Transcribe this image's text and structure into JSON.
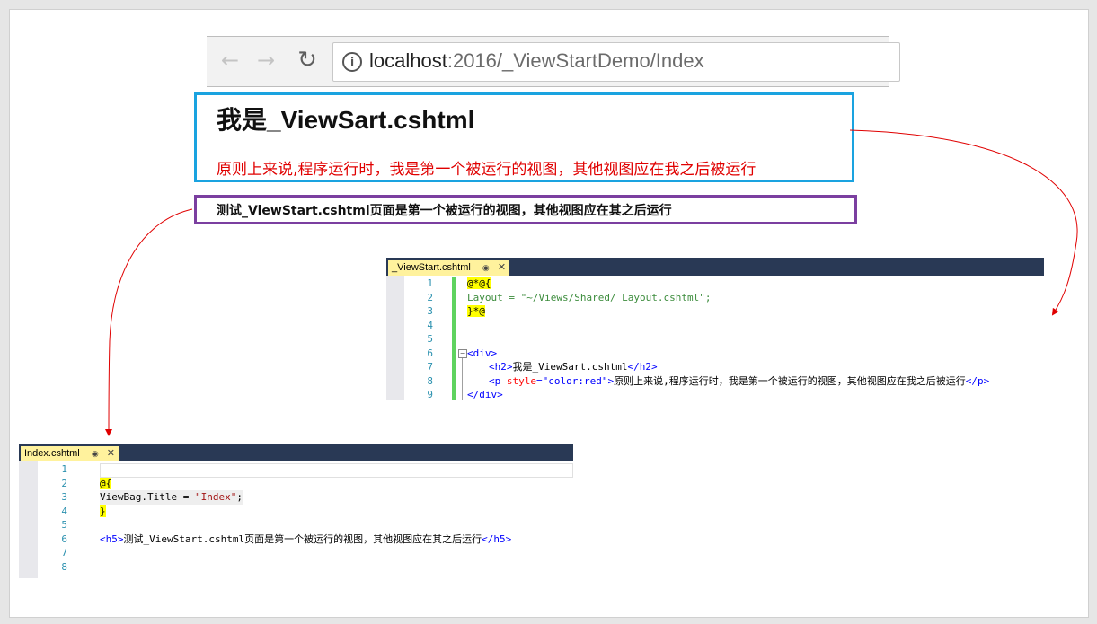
{
  "browser": {
    "back_icon": "back-arrow-icon",
    "forward_icon": "forward-arrow-icon",
    "reload_icon": "reload-icon",
    "url_host": "localhost",
    "url_rest": ":2016/_ViewStartDemo/Index"
  },
  "preview": {
    "layout_heading": "我是_ViewSart.cshtml",
    "layout_paragraph": "原则上来说,程序运行时，我是第一个被运行的视图，其他视图应在我之后被运行",
    "index_heading": "测试_ViewStart.cshtml页面是第一个被运行的视图，其他视图应在其之后运行"
  },
  "colors": {
    "layout_box_border": "#1aa3e0",
    "index_box_border": "#7b3fa0",
    "arrow": "#e00000",
    "paragraph_red": "#e00000"
  },
  "viewstart_editor": {
    "tab_label": "_ViewStart.cshtml",
    "pin_icon": "pin-icon",
    "close_icon": "close-icon",
    "line_numbers": [
      "1",
      "2",
      "3",
      "4",
      "5",
      "6",
      "7",
      "8",
      "9"
    ],
    "lines": {
      "l1_open": "@*@{",
      "l2_layout": "    Layout = \"~/Views/Shared/_Layout.cshtml\";",
      "l3_close": "}*@",
      "l6_div_open": "<div>",
      "l7_h2_open": "<h2>",
      "l7_h2_text": "我是_ViewSart.cshtml",
      "l7_h2_close": "</h2>",
      "l8_p_open": "<p ",
      "l8_p_attr": "style",
      "l8_p_eq": "=",
      "l8_p_val": "\"color:red\"",
      "l8_p_gt": ">",
      "l8_p_text": "原则上来说,程序运行时，我是第一个被运行的视图，其他视图应在我之后被运行",
      "l8_p_close": "</p>",
      "l9_div_close": "</div>"
    }
  },
  "index_editor": {
    "tab_label": "Index.cshtml",
    "pin_icon": "pin-icon",
    "close_icon": "close-icon",
    "line_numbers": [
      "1",
      "2",
      "3",
      "4",
      "5",
      "6",
      "7",
      "8"
    ],
    "lines": {
      "l2_open": "@{",
      "l3_title_a": "    ViewBag.Title = ",
      "l3_title_str": "\"Index\"",
      "l3_title_end": ";",
      "l4_close": "}",
      "l6_h5_open": "<h5>",
      "l6_h5_text": "测试_ViewStart.cshtml页面是第一个被运行的视图，其他视图应在其之后运行",
      "l6_h5_close": "</h5>"
    }
  }
}
